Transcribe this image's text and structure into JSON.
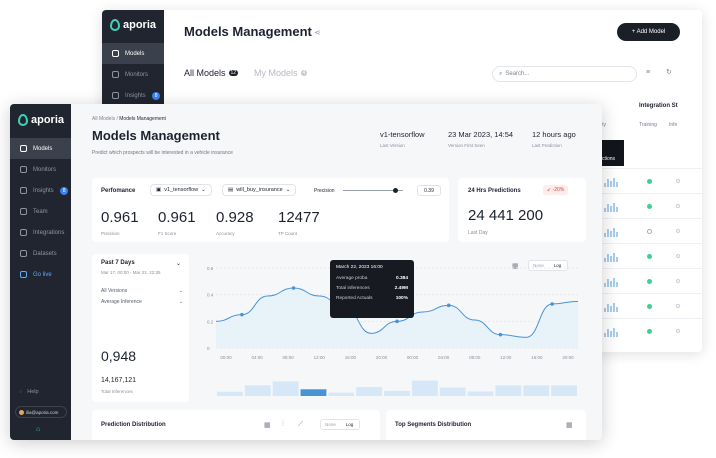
{
  "brand": "aporia",
  "back": {
    "sidebar": [
      {
        "label": "Models",
        "active": true
      },
      {
        "label": "Monitors"
      },
      {
        "label": "Insights",
        "badge": "8"
      }
    ],
    "title": "Models Management",
    "add_button": "+ Add Model",
    "tab_all": "All Models",
    "tab_all_count": "12",
    "tab_my": "My Models",
    "tab_my_count": "4",
    "search_placeholder": "Search...",
    "integration_header": "Integration St",
    "activity_col": "tivity",
    "training_col": "Training",
    "infer_col": "Infe",
    "tooltip_fragment": "ctions"
  },
  "front": {
    "sidebar": [
      {
        "label": "Models",
        "icon": "models-icon",
        "active": true
      },
      {
        "label": "Monitors",
        "icon": "monitor-icon"
      },
      {
        "label": "Insights",
        "icon": "bulb-icon",
        "badge": "8"
      },
      {
        "label": "Team",
        "icon": "team-icon"
      },
      {
        "label": "Integrations",
        "icon": "integrations-icon"
      },
      {
        "label": "Datasets",
        "icon": "datasets-icon"
      },
      {
        "label": "Go live",
        "icon": "bolt-icon",
        "highlight": true
      }
    ],
    "help": "Help",
    "user": "ilia@aporia.com",
    "breadcrumb": {
      "root": "All Models",
      "sep": "/",
      "current": "Models Management"
    },
    "title": "Models Management",
    "subtitle": "Predict which prospects will be interested in a vehicle insurance",
    "meta": [
      {
        "value": "v1-tensorflow",
        "label": "Last Version"
      },
      {
        "value": "23 Mar 2023, 14:54",
        "label": "Version First Seen"
      },
      {
        "value": "12 hours ago",
        "label": "Last Prediction"
      }
    ],
    "performance": {
      "label": "Perfomance",
      "version": "v1_tensorflow",
      "target": "will_buy_insurance",
      "metric": "Precision",
      "slider_value": "0.39",
      "slider_fraction": 0.84,
      "metrics": [
        {
          "value": "0.961",
          "label": "Precision"
        },
        {
          "value": "0.961",
          "label": "F1 Score"
        },
        {
          "value": "0.928",
          "label": "Accuracy"
        },
        {
          "value": "12477",
          "label": "TP Count"
        }
      ]
    },
    "predictions24": {
      "label": "24 Hrs Predictions",
      "delta": "-20%",
      "value": "24 441 200",
      "sub": "Last Day"
    },
    "panel": {
      "period": "Past 7 Days",
      "range": "Mar 17, 00:00 - Mar 22, 22:35",
      "versions": "All Versions",
      "metric": "Average Inference",
      "value": "0,948",
      "total": "14,167,121",
      "total_label": "Total Inferences"
    },
    "chart": {
      "toggle_none": "None",
      "toggle_log": "Log",
      "tooltip": {
        "date": "March 22, 2023 16:00",
        "rows": [
          {
            "label": "Average proba",
            "value": "0.384"
          },
          {
            "label": "Total inferences",
            "value": "2.49M"
          },
          {
            "label": "Reported Actuals",
            "value": "100%"
          }
        ]
      }
    },
    "prediction_distribution": "Prediction Distribution",
    "dist_toggle_none": "None",
    "dist_toggle_log": "Log",
    "top_segments": "Top Segments Distribution"
  },
  "chart_data": {
    "type": "line",
    "x": [
      "00:00",
      "04:00",
      "08:00",
      "12:00",
      "16:00",
      "20:00",
      "00:00",
      "04:00",
      "08:00",
      "12:00",
      "16:00",
      "20:00"
    ],
    "yticks": [
      "0",
      "0.2",
      "0.4",
      "0.6"
    ],
    "ylim": [
      0,
      0.6
    ],
    "series": [
      {
        "values": [
          0.2,
          0.25,
          0.39,
          0.45,
          0.39,
          0.3,
          0.11,
          0.2,
          0.27,
          0.32,
          0.21,
          0.1,
          0.08,
          0.33,
          0.35
        ]
      }
    ],
    "volume": [
      0.15,
      0.38,
      0.52,
      0.24,
      0.12,
      0.32,
      0.18,
      0.55,
      0.3,
      0.16,
      0.38,
      0.38,
      0.38
    ]
  }
}
